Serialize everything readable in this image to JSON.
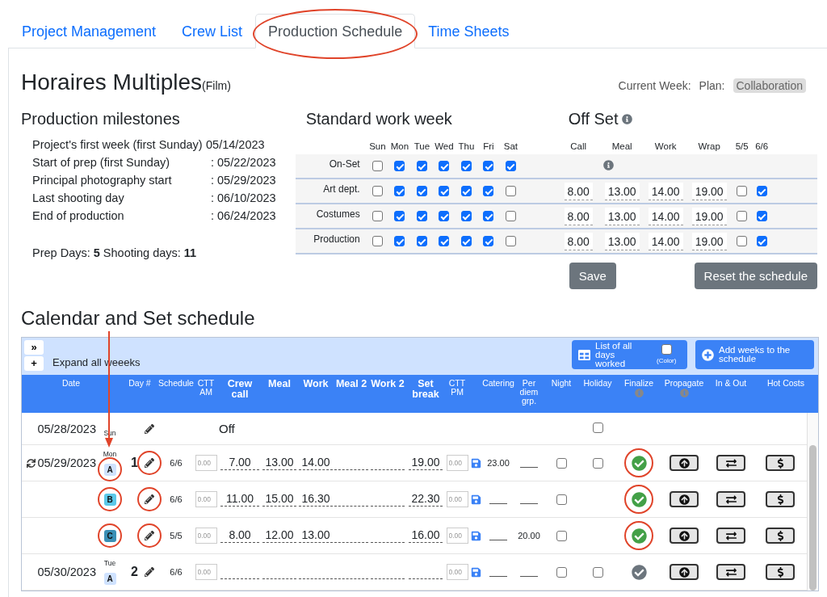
{
  "tabs": [
    {
      "label": "Project Management",
      "selected": false,
      "annotated": false
    },
    {
      "label": "Crew List",
      "selected": false,
      "annotated": false
    },
    {
      "label": "Production Schedule",
      "selected": true,
      "annotated": true
    },
    {
      "label": "Time Sheets",
      "selected": false,
      "annotated": false
    }
  ],
  "title": "Horaires Multiples",
  "title_suffix": "(Film)",
  "current_week_label": "Current Week:",
  "plan_label": "Plan:",
  "plan_badge": "Collaboration",
  "milestones": {
    "heading": "Production milestones",
    "items": [
      {
        "label": "Project's first week (first Sunday)",
        "value": "05/14/2023"
      },
      {
        "label": "Start of prep (first Sunday)",
        "value": ": 05/22/2023"
      },
      {
        "label": "Principal photography start",
        "value": ": 05/29/2023"
      },
      {
        "label": "Last shooting day",
        "value": ": 06/10/2023"
      },
      {
        "label": "End of production",
        "value": ": 06/24/2023"
      }
    ],
    "summary": "Prep Days: **5**  Shooting days: **11**"
  },
  "work_week": {
    "heading": "Standard work week",
    "days": [
      "Sun",
      "Mon",
      "Tue",
      "Wed",
      "Thu",
      "Fri",
      "Sat"
    ],
    "off_set_heading": "Off Set",
    "off_set_columns": [
      "Call",
      "Meal",
      "Work",
      "Wrap",
      "5/5",
      "6/6"
    ],
    "rows": [
      {
        "label": "On-Set",
        "days": [
          false,
          true,
          true,
          true,
          true,
          true,
          true
        ],
        "kind": "info"
      },
      {
        "label": "Art dept.",
        "days": [
          false,
          true,
          true,
          true,
          true,
          true,
          false
        ],
        "kind": "times",
        "times": [
          "8.00",
          "13.00",
          "14.00",
          "19.00"
        ],
        "five_five": false,
        "six_six": true
      },
      {
        "label": "Costumes",
        "days": [
          false,
          true,
          true,
          true,
          true,
          true,
          false
        ],
        "kind": "times",
        "times": [
          "8.00",
          "13.00",
          "14.00",
          "19.00"
        ],
        "five_five": false,
        "six_six": true
      },
      {
        "label": "Production",
        "days": [
          false,
          true,
          true,
          true,
          true,
          true,
          false
        ],
        "kind": "times",
        "times": [
          "8.00",
          "13.00",
          "14.00",
          "19.00"
        ],
        "five_five": false,
        "six_six": true
      }
    ],
    "save_button": "Save",
    "reset_button": "Reset the schedule"
  },
  "calendar": {
    "heading": "Calendar and Set schedule",
    "collapse_button": "»",
    "add_button": "+",
    "expand_label": "Expand all weeeks",
    "list_button": "List of all days worked",
    "color_checkbox": {
      "label": "(Color)",
      "checked": false
    },
    "add_weeks_button": "Add weeks to the schedule",
    "columns": [
      {
        "label": "Date",
        "emphasis": false,
        "info": false
      },
      {
        "label": "Day #",
        "emphasis": false,
        "info": false
      },
      {
        "label": "Schedule",
        "emphasis": false,
        "info": false
      },
      {
        "label": "CTT AM",
        "emphasis": false,
        "info": false
      },
      {
        "label": "Crew call",
        "emphasis": true,
        "info": false
      },
      {
        "label": "Meal",
        "emphasis": true,
        "info": false
      },
      {
        "label": "Work",
        "emphasis": true,
        "info": false
      },
      {
        "label": "Meal 2",
        "emphasis": true,
        "info": false
      },
      {
        "label": "Work 2",
        "emphasis": true,
        "info": false
      },
      {
        "label": "Set break",
        "emphasis": true,
        "info": false
      },
      {
        "label": "CTT PM",
        "emphasis": false,
        "info": false
      },
      {
        "label": "Catering",
        "emphasis": false,
        "info": false
      },
      {
        "label": "Per diem grp.",
        "emphasis": false,
        "info": false
      },
      {
        "label": "Night",
        "emphasis": false,
        "info": false
      },
      {
        "label": "Holiday",
        "emphasis": false,
        "info": false
      },
      {
        "label": "Finalize",
        "emphasis": false,
        "info": true
      },
      {
        "label": "Propagate",
        "emphasis": false,
        "info": true
      },
      {
        "label": "In & Out",
        "emphasis": false,
        "info": false
      },
      {
        "label": "Hot Costs",
        "emphasis": false,
        "info": false
      }
    ],
    "rows": [
      {
        "kind": "off",
        "date": "05/28/2023",
        "weekday": "Sun",
        "status": "Off",
        "holiday": false
      },
      {
        "kind": "shift",
        "sync": true,
        "date": "05/29/2023",
        "weekday": "Mon",
        "shift": "A",
        "color": "#cfe2ff",
        "day": "1",
        "schedule": "6/6",
        "ctt_am_placeholder": "0.00",
        "crew_call": "7.00",
        "meal": "13.00",
        "work": "14.00",
        "set_break": "19.00",
        "ctt_pm_placeholder": "0.00",
        "catering": "23.00",
        "night": false,
        "holiday": false,
        "finalized": true,
        "annotated": true
      },
      {
        "kind": "shift",
        "sync": false,
        "shift": "B",
        "color": "#5bc8e8",
        "schedule": "6/6",
        "ctt_am_placeholder": "0.00",
        "crew_call": "11.00",
        "meal": "15.00",
        "work": "16.30",
        "set_break": "22.30",
        "ctt_pm_placeholder": "0.00",
        "night": false,
        "finalized": true,
        "annotated": true
      },
      {
        "kind": "shift",
        "sync": false,
        "shift": "C",
        "color": "#3a8fb5",
        "schedule": "5/5",
        "ctt_am_placeholder": "0.00",
        "crew_call": "8.00",
        "meal": "12.00",
        "work": "13.00",
        "set_break": "16.00",
        "ctt_pm_placeholder": "0.00",
        "per_diem": "20.00",
        "night": false,
        "finalized": true,
        "annotated": true
      },
      {
        "kind": "shift",
        "sync": false,
        "date": "05/30/2023",
        "weekday": "Tue",
        "shift": "A",
        "color": "#cfe2ff",
        "day": "2",
        "schedule": "6/6",
        "ctt_am_placeholder": "0.00",
        "ctt_pm_placeholder": "0.00",
        "night": false,
        "holiday": false,
        "finalized": false,
        "annotated": false
      }
    ]
  }
}
